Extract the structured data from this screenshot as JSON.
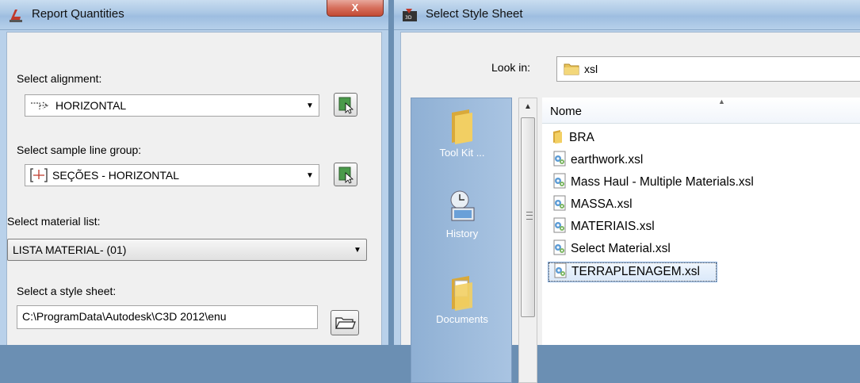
{
  "report": {
    "title": "Report Quantities",
    "close_label": "X",
    "alignment_label": "Select alignment:",
    "alignment_value": "HORIZONTAL",
    "sample_group_label": "Select sample line group:",
    "sample_group_value": "SEÇÕES - HORIZONTAL",
    "material_label": "Select material list:",
    "material_value": "LISTA MATERIAL- (01)",
    "stylesheet_label": "Select a style sheet:",
    "stylesheet_value": "C:\\ProgramData\\Autodesk\\C3D 2012\\enu"
  },
  "stylesheet_dialog": {
    "title": "Select Style Sheet",
    "look_in_label": "Look in:",
    "look_in_value": "xsl",
    "places": [
      "Tool Kit ...",
      "History",
      "Documents"
    ],
    "column_header": "Nome",
    "items": [
      {
        "name": "BRA",
        "icon": "folder-icon",
        "selected": false
      },
      {
        "name": "earthwork.xsl",
        "icon": "xsl-file-icon",
        "selected": false
      },
      {
        "name": "Mass Haul - Multiple Materials.xsl",
        "icon": "xsl-file-icon",
        "selected": false
      },
      {
        "name": "MASSA.xsl",
        "icon": "xsl-file-icon",
        "selected": false
      },
      {
        "name": "MATERIAIS.xsl",
        "icon": "xsl-file-icon",
        "selected": false
      },
      {
        "name": "Select Material.xsl",
        "icon": "xsl-file-icon",
        "selected": false
      },
      {
        "name": "TERRAPLENAGEM.xsl",
        "icon": "xsl-file-icon",
        "selected": true
      }
    ]
  },
  "colors": {
    "title_bar": "#a9c6e4",
    "close_button": "#d66f5c",
    "places_bar": "#9bbadc",
    "selection": "#dbe9f9"
  }
}
